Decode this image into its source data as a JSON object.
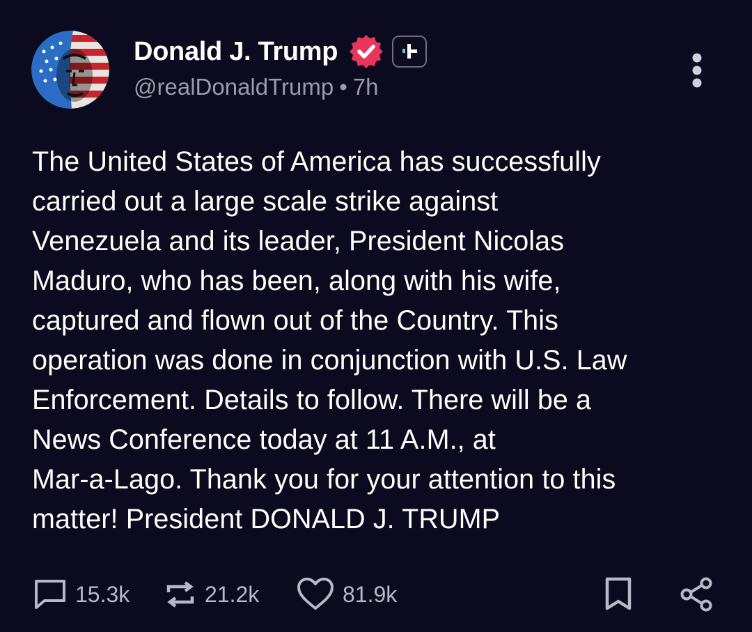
{
  "author": {
    "display_name": "Donald J. Trump",
    "handle": "@realDonaldTrump",
    "separator": "•",
    "time_ago": "7h",
    "verified_color": "#e8365d"
  },
  "post": {
    "text_lines": [
      "The United States of America has successfully",
      "carried out a large scale strike against",
      "Venezuela and its leader, President Nicolas",
      "Maduro, who has been, along with his wife,",
      "captured and flown out of the Country. This",
      "operation was done in conjunction with U.S. Law",
      "Enforcement. Details to follow. There will be a",
      "News Conference today at 11 A.M., at",
      "Mar-a-Lago. Thank you for your attention to this",
      "matter! President DONALD J. TRUMP"
    ]
  },
  "actions": {
    "replies": "15.3k",
    "reposts": "21.2k",
    "likes": "81.9k"
  },
  "icons": {
    "verified": "verified-badge-icon",
    "plus": "plus-badge-icon",
    "more": "more-vertical-icon",
    "reply": "reply-icon",
    "repost": "repost-icon",
    "like": "heart-icon",
    "bookmark": "bookmark-icon",
    "share": "share-icon"
  },
  "colors": {
    "background": "#0b0a1e",
    "text": "#ffffff",
    "muted": "#9a9bab",
    "accent": "#e8365d",
    "plus_accent": "#5fd3c6"
  }
}
